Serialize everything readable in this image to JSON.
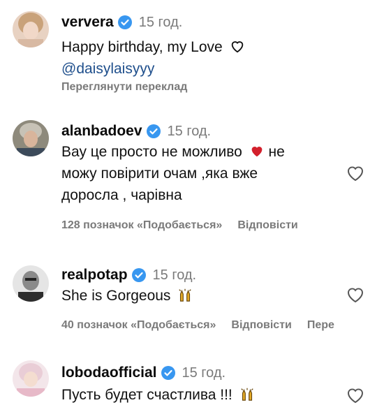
{
  "comments": [
    {
      "username": "ververa",
      "time": "15 год.",
      "text": "Happy birthday, my Love",
      "text_emoji_icon": "outline-heart-icon",
      "mention": "@daisylaisyyy",
      "translate_label": "Переглянути переклад"
    },
    {
      "username": "alanbadoev",
      "time": "15 год.",
      "text_line1": "Вау це просто не можливо",
      "text_emoji_icon": "red-heart-icon",
      "text_line1_end": "не",
      "text_line2": "можу повірити очам ,яка вже",
      "text_line3": "доросла , чарівна",
      "likes": "128 позначок «Подобається»",
      "reply": "Відповісти"
    },
    {
      "username": "realpotap",
      "time": "15 год.",
      "text": "She is Gorgeous",
      "text_emoji_icon": "raising-hands-icon",
      "likes": "40 позначок «Подобається»",
      "reply": "Відповісти",
      "extra": "Пере"
    },
    {
      "username": "lobodaofficial",
      "time": "15 год.",
      "text": "Пусть будет счастлива !!!",
      "text_emoji_icon": "raising-hands-icon"
    }
  ],
  "colors": {
    "verified_blue": "#3897f0",
    "secondary_text": "#7a7a7a",
    "mention_link": "#1f4f8c",
    "red_heart": "#d3202c"
  }
}
